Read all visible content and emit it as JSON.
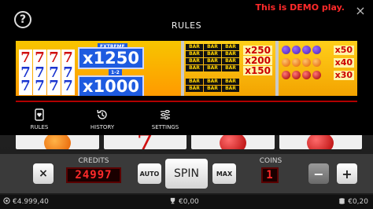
{
  "header": {
    "demo_text": "This is DEMO play.",
    "title": "RULES",
    "help_label": "?",
    "close_label": "×"
  },
  "paytable": {
    "left": {
      "top_symbols": [
        "7",
        "7",
        "7",
        "7"
      ],
      "top_multiplier": "x1250",
      "top_tag": "EXTREME",
      "bottom_symbols": [
        "7",
        "7",
        "7",
        "7"
      ],
      "bottom_multiplier": "x1000",
      "bottom_tag": "1-2",
      "mid_symbols": [
        "7",
        "7",
        "7",
        "7"
      ]
    },
    "middle": {
      "bar_label": "BAR",
      "multipliers": [
        "x250",
        "x200",
        "x150"
      ]
    },
    "right": {
      "multipliers": [
        "x50",
        "x40",
        "x30"
      ]
    }
  },
  "tabs": [
    {
      "label": "RULES",
      "icon": "heart-card-icon"
    },
    {
      "label": "HISTORY",
      "icon": "history-icon"
    },
    {
      "label": "SETTINGS",
      "icon": "sliders-icon"
    }
  ],
  "controls": {
    "close_label": "×",
    "credits_label": "CREDITS",
    "credits_value": "24997",
    "auto_label": "AUTO",
    "spin_label": "SPIN",
    "max_label": "MAX",
    "coins_label": "COINS",
    "coins_value": "1",
    "minus_label": "−",
    "plus_label": "+"
  },
  "status": {
    "balance": "€4.999,40",
    "win": "€0,00",
    "bet": "€0,20"
  }
}
